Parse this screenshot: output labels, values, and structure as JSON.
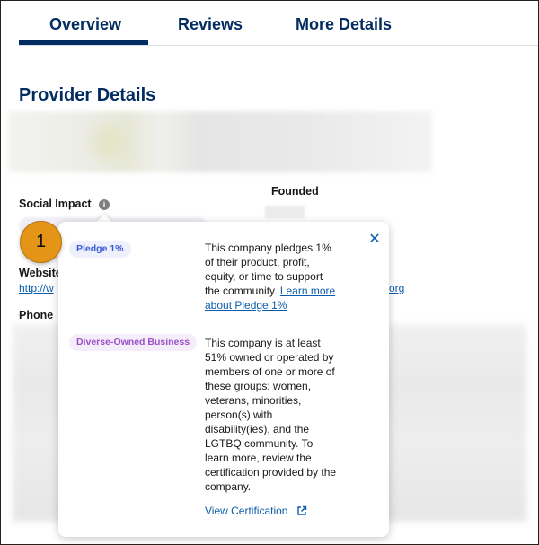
{
  "tabs": [
    {
      "label": "Overview",
      "active": true
    },
    {
      "label": "Reviews",
      "active": false
    },
    {
      "label": "More Details",
      "active": false
    }
  ],
  "section_title": "Provider Details",
  "labels": {
    "social_impact": "Social Impact",
    "founded": "Founded",
    "website": "Website",
    "phone": "Phone"
  },
  "website_link_start": "http://w",
  "website_link_end": "org",
  "popover": {
    "items": [
      {
        "badge": "Pledge 1%",
        "description": "This company pledges 1% of their product, profit, equity, or time to support the community.",
        "link_text": "Learn more about Pledge 1%"
      },
      {
        "badge": "Diverse-Owned Business",
        "description": "This company is at least 51% owned or operated by members of one or more of these groups: women, veterans, minorities, person(s) with disability(ies), and the LGTBQ community. To learn more, review the certification provided by the company."
      }
    ],
    "cert_link": "View Certification",
    "close_icon": "close-icon"
  },
  "step_marker": "1",
  "colors": {
    "brand_navy": "#032d60",
    "link_blue": "#0b5cab",
    "marker_orange": "#e49416",
    "pledge_badge": "#3a5bd9",
    "diverse_badge": "#9b50c7"
  }
}
